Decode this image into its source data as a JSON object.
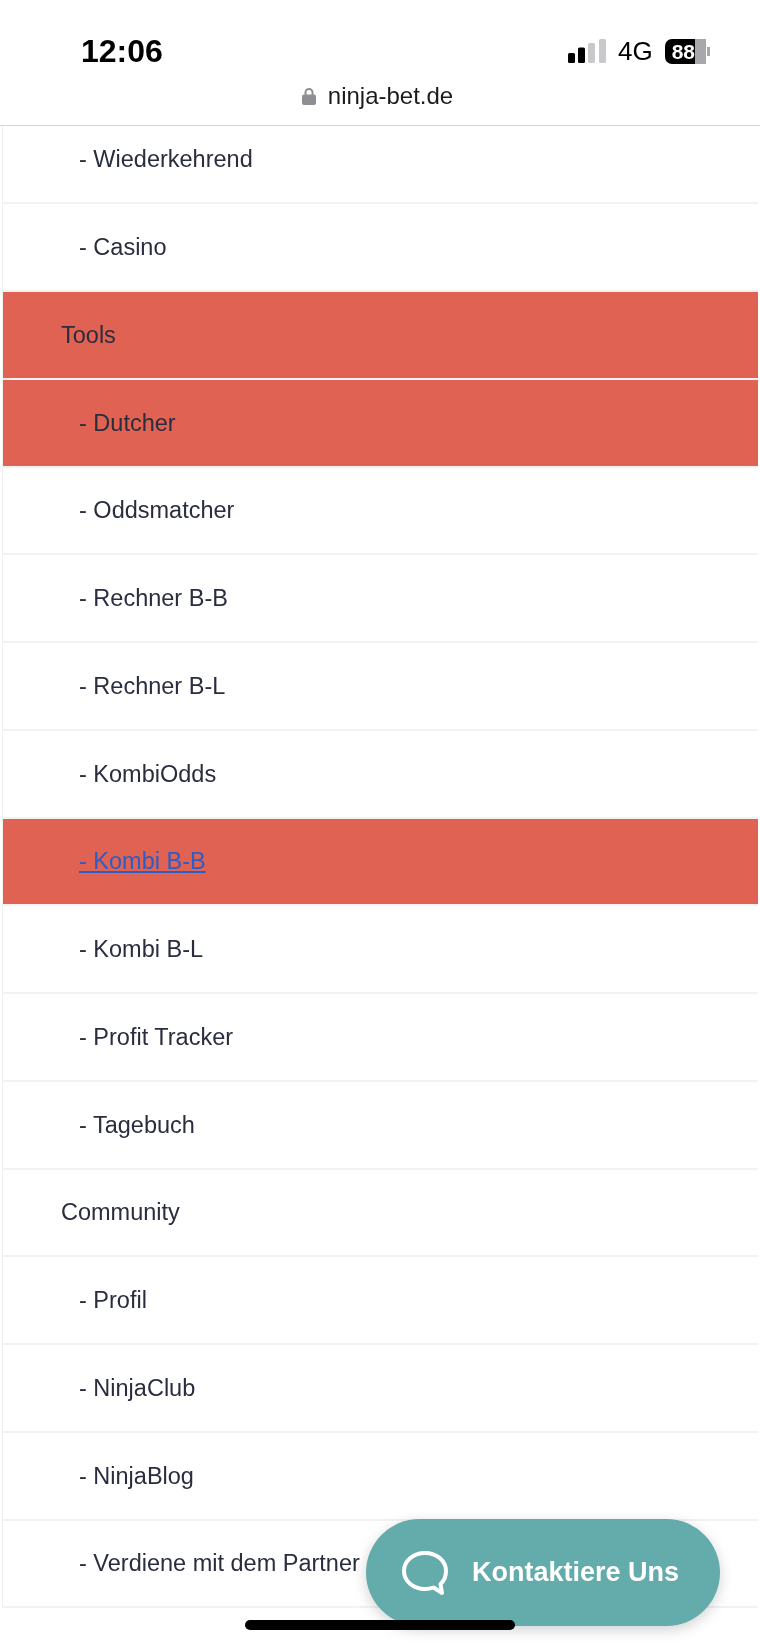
{
  "status_bar": {
    "time": "12:06",
    "network": "4G",
    "battery": "88"
  },
  "address_bar": {
    "url": "ninja-bet.de"
  },
  "menu": [
    {
      "children": [
        {
          "label": "- Wiederkehrend",
          "selected": false,
          "current": false
        },
        {
          "label": "- Casino",
          "selected": false,
          "current": false
        }
      ]
    },
    {
      "label": "Tools",
      "selected": true,
      "children": [
        {
          "label": "- Dutcher",
          "selected": true,
          "current": false
        },
        {
          "label": "- Oddsmatcher",
          "selected": false,
          "current": false
        },
        {
          "label": "- Rechner B-B",
          "selected": false,
          "current": false
        },
        {
          "label": "- Rechner B-L",
          "selected": false,
          "current": false
        },
        {
          "label": "- KombiOdds",
          "selected": false,
          "current": false
        },
        {
          "label": "- Kombi B-B",
          "selected": true,
          "current": true
        },
        {
          "label": "- Kombi B-L",
          "selected": false,
          "current": false
        },
        {
          "label": "- Profit Tracker",
          "selected": false,
          "current": false
        },
        {
          "label": "- Tagebuch",
          "selected": false,
          "current": false
        }
      ]
    },
    {
      "label": "Community",
      "selected": false,
      "children": [
        {
          "label": "- Profil",
          "selected": false,
          "current": false
        },
        {
          "label": "- NinjaClub",
          "selected": false,
          "current": false
        },
        {
          "label": "- NinjaBlog",
          "selected": false,
          "current": false
        },
        {
          "label": "- Verdiene mit dem Partner",
          "selected": false,
          "current": false
        }
      ]
    }
  ],
  "contact_button": {
    "label": "Kontaktiere Uns"
  }
}
